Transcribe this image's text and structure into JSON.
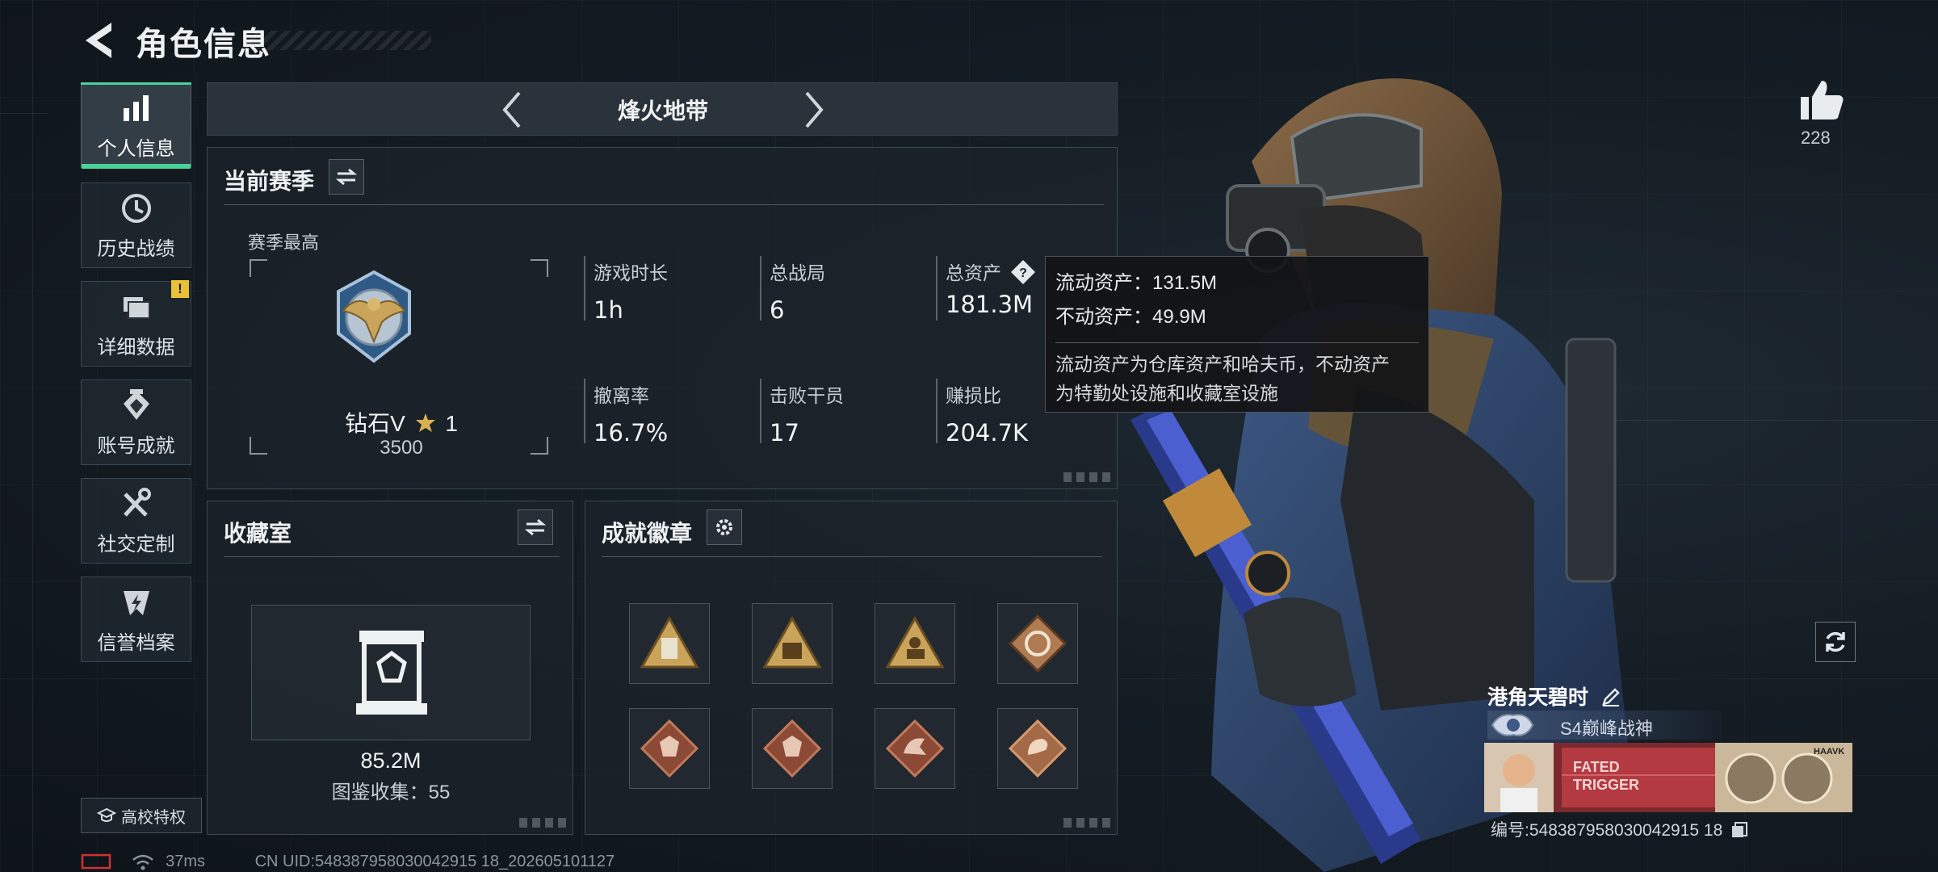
{
  "header": {
    "title": "角色信息"
  },
  "sidebar": {
    "items": [
      {
        "label": "个人信息",
        "icon": "bar-chart-icon"
      },
      {
        "label": "历史战绩",
        "icon": "clock-icon"
      },
      {
        "label": "详细数据",
        "icon": "folder-icon",
        "badge": "!"
      },
      {
        "label": "账号成就",
        "icon": "achievement-icon"
      },
      {
        "label": "社交定制",
        "icon": "tools-icon"
      },
      {
        "label": "信誉档案",
        "icon": "shield-bolt-icon"
      }
    ],
    "campus": {
      "label": "高校特权"
    }
  },
  "mode": {
    "title": "烽火地带"
  },
  "season": {
    "title": "当前赛季",
    "best_label": "赛季最高",
    "rank_name": "钻石V",
    "rank_stars": "1",
    "rank_score": "3500",
    "stats": [
      {
        "label": "游戏时长",
        "value": "1h"
      },
      {
        "label": "总战局",
        "value": "6"
      },
      {
        "label": "总资产",
        "value": "181.3M"
      },
      {
        "label": "撤离率",
        "value": "16.7%"
      },
      {
        "label": "击败干员",
        "value": "17"
      },
      {
        "label": "赚损比",
        "value": "204.7K"
      }
    ]
  },
  "tooltip": {
    "liquid": "流动资产：131.5M",
    "fixed": "不动资产：49.9M",
    "desc_line1": "流动资产为仓库资产和哈夫币，不动资产",
    "desc_line2": "为特勤处设施和收藏室设施"
  },
  "collection": {
    "title": "收藏室",
    "value": "85.2M",
    "catalog": "图鉴收集：55"
  },
  "achievements": {
    "title": "成就徽章",
    "badges": [
      "badge-1",
      "badge-2",
      "badge-3",
      "badge-4",
      "badge-5",
      "badge-6",
      "badge-7",
      "badge-8"
    ]
  },
  "profile": {
    "likes": "228",
    "name": "港角天碧时",
    "title": "S4巅峰战神",
    "id": "编号:548387958030042915 18"
  },
  "status": {
    "ping": "37ms",
    "uid": "CN UID:548387958030042915 18_202605101127"
  },
  "colors": {
    "accent": "#47d39a",
    "warn": "#e9c238",
    "gold": "#c9a45a",
    "bronze": "#b07b52"
  }
}
